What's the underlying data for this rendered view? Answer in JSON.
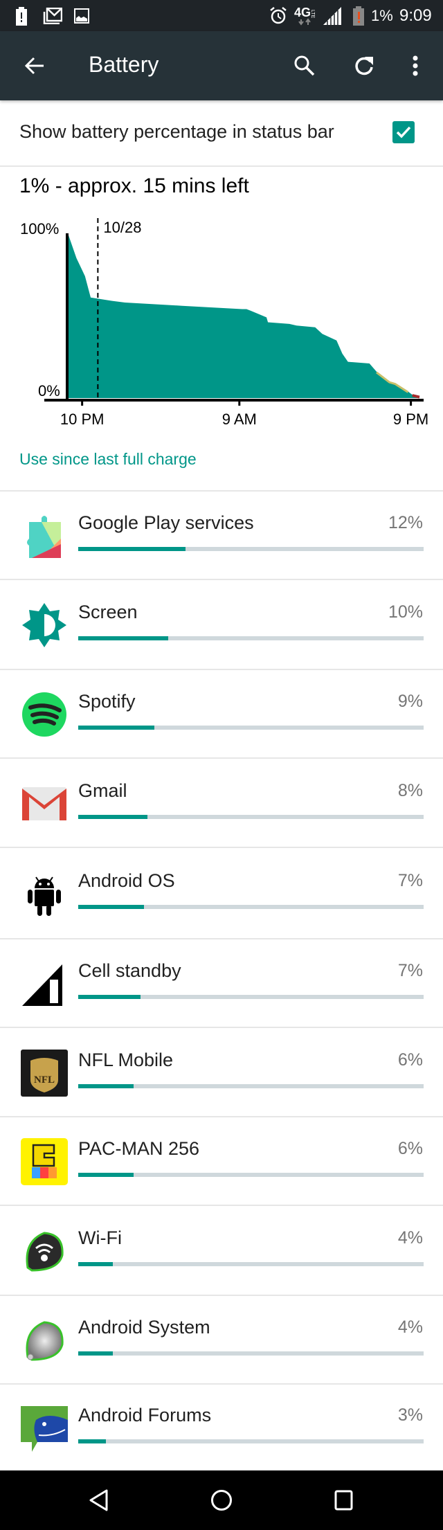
{
  "status_bar": {
    "left_icons": [
      "battery-alert-icon",
      "gmail-notification-icon",
      "image-notification-icon"
    ],
    "right_icons": [
      "alarm-icon",
      "4g-lte-icon",
      "signal-icon",
      "battery-low-icon"
    ],
    "battery_text": "1%",
    "time": "9:09"
  },
  "app_bar": {
    "title": "Battery",
    "back_icon": "arrow-left-icon",
    "actions": [
      "search-icon",
      "refresh-icon",
      "more-vert-icon"
    ]
  },
  "preference": {
    "label": "Show battery percentage in status bar",
    "checked": true
  },
  "summary": "1% - approx. 15 mins left",
  "chart_data": {
    "type": "area",
    "title": "",
    "ylabel": "",
    "xlabel": "",
    "y_tick_labels": [
      "100%",
      "0%"
    ],
    "ylim": [
      0,
      100
    ],
    "x_tick_labels": [
      "10 PM",
      "9 AM",
      "9 PM"
    ],
    "x_ticks_hours": [
      1,
      12,
      24
    ],
    "date_marker": {
      "label": "10/28",
      "hours": 2.1
    },
    "xlim_hours": [
      0,
      24.6
    ],
    "series": [
      {
        "name": "battery level",
        "color": "#009688",
        "x_hours": [
          0,
          0.6,
          1.2,
          1.6,
          3.1,
          4.0,
          8.0,
          12.2,
          12.5,
          12.8,
          13.9,
          14.0,
          15.5,
          16.0,
          17.3,
          17.8,
          18.8,
          19.2,
          19.6,
          21.1,
          21.6,
          22.5,
          22.9,
          23.8,
          24.1,
          24.6
        ],
        "y_percent": [
          100,
          85,
          74,
          61,
          59,
          58,
          56,
          54,
          54,
          53,
          49,
          46,
          45,
          44,
          43,
          39,
          35,
          27,
          22,
          21,
          16,
          10,
          9,
          4,
          2,
          1
        ]
      }
    ],
    "low_battery_segments": [
      {
        "color": "#c8c06a",
        "from_hours": 21.6,
        "to_hours": 24.0
      },
      {
        "color": "#a52a2a",
        "from_hours": 24.0,
        "to_hours": 24.6
      }
    ],
    "grid": false,
    "legend": "none"
  },
  "section_link": "Use since last full charge",
  "usage_items": [
    {
      "name": "Google Play services",
      "percent": "12%",
      "bar_fraction": 0.31,
      "icon": "google-play-services-icon"
    },
    {
      "name": "Screen",
      "percent": "10%",
      "bar_fraction": 0.26,
      "icon": "brightness-icon"
    },
    {
      "name": "Spotify",
      "percent": "9%",
      "bar_fraction": 0.22,
      "icon": "spotify-icon"
    },
    {
      "name": "Gmail",
      "percent": "8%",
      "bar_fraction": 0.2,
      "icon": "gmail-icon"
    },
    {
      "name": "Android OS",
      "percent": "7%",
      "bar_fraction": 0.19,
      "icon": "android-robot-icon"
    },
    {
      "name": "Cell standby",
      "percent": "7%",
      "bar_fraction": 0.18,
      "icon": "cell-signal-icon"
    },
    {
      "name": "NFL Mobile",
      "percent": "6%",
      "bar_fraction": 0.16,
      "icon": "nfl-icon"
    },
    {
      "name": "PAC-MAN 256",
      "percent": "6%",
      "bar_fraction": 0.16,
      "icon": "pacman-256-icon"
    },
    {
      "name": "Wi-Fi",
      "percent": "4%",
      "bar_fraction": 0.1,
      "icon": "wifi-icon"
    },
    {
      "name": "Android System",
      "percent": "4%",
      "bar_fraction": 0.1,
      "icon": "android-system-icon"
    },
    {
      "name": "Android Forums",
      "percent": "3%",
      "bar_fraction": 0.08,
      "icon": "android-forums-icon"
    }
  ],
  "nav_bar": [
    "back-triangle-icon",
    "home-circle-icon",
    "recents-square-icon"
  ],
  "colors": {
    "accent": "#009688",
    "app_bar": "#263238",
    "status_bar": "#1f2428"
  }
}
